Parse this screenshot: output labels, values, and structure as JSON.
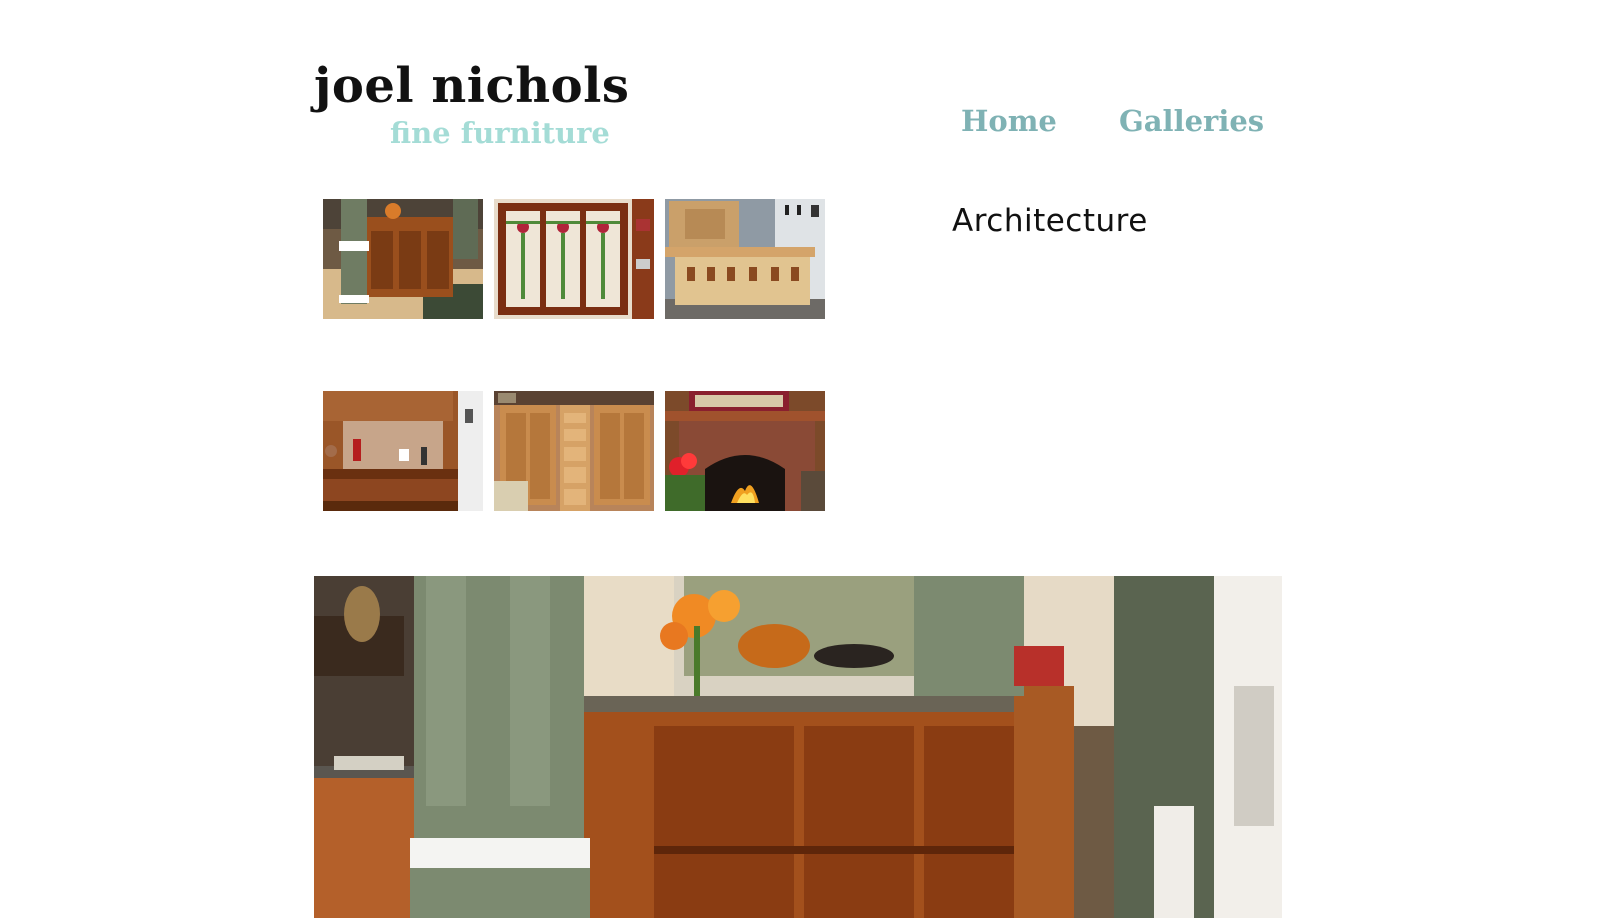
{
  "header": {
    "title": "joel nichols",
    "subtitle": "fine furniture"
  },
  "nav": {
    "items": [
      {
        "label": "Home"
      },
      {
        "label": "Galleries"
      }
    ]
  },
  "gallery": {
    "title": "Architecture",
    "thumbnails": [
      {
        "subject": "sapele-cabinet-with-column"
      },
      {
        "subject": "stained-glass-windows"
      },
      {
        "subject": "maple-bar-counter"
      },
      {
        "subject": "wet-bar-cabinetry"
      },
      {
        "subject": "built-in-drawers-wall-unit"
      },
      {
        "subject": "brick-fireplace-mantel"
      }
    ],
    "featured_image": {
      "subject": "sapele-cabinet-with-column-large"
    }
  },
  "colors": {
    "title": "#111111",
    "subtitle": "#a4dcd6",
    "nav_link": "#7fb2b4"
  }
}
